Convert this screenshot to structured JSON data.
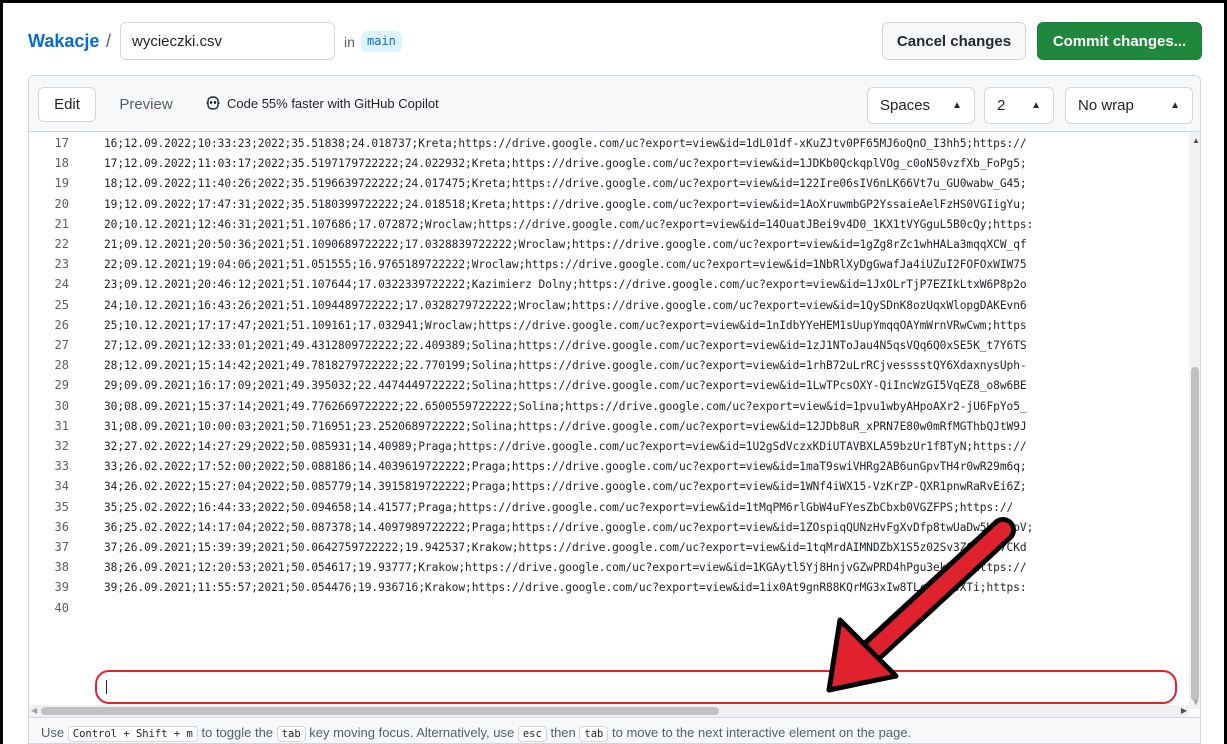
{
  "header": {
    "repo": "Wakacje",
    "separator": "/",
    "filename": "wycieczki.csv",
    "in_label": "in",
    "branch": "main",
    "cancel_label": "Cancel changes",
    "commit_label": "Commit changes..."
  },
  "toolbar": {
    "edit_label": "Edit",
    "preview_label": "Preview",
    "copilot_text": "Code 55% faster with GitHub Copilot",
    "indent_mode": "Spaces",
    "indent_size": "2",
    "wrap_mode": "No wrap"
  },
  "editor": {
    "lines": [
      {
        "num": "17",
        "text": "16;12.09.2022;10:33:23;2022;35.51838;24.018737;Kreta;https://drive.google.com/uc?export=view&id=1dL01df-xKuZJtv0PF65MJ6oQnO_I3hh5;https://"
      },
      {
        "num": "18",
        "text": "17;12.09.2022;11:03:17;2022;35.5197179722222;24.022932;Kreta;https://drive.google.com/uc?export=view&id=1JDKb0QckqplVOg_c0oN50vzfXb_FoPg5;"
      },
      {
        "num": "19",
        "text": "18;12.09.2022;11:40:26;2022;35.5196639722222;24.017475;Kreta;https://drive.google.com/uc?export=view&id=122Ire06sIV6nLK66Vt7u_GU0wabw_G45;"
      },
      {
        "num": "20",
        "text": "19;12.09.2022;17:47:31;2022;35.5180399722222;24.018518;Kreta;https://drive.google.com/uc?export=view&id=1AoXruwmbGP2YssaieAelFzHS0VGIigYu;"
      },
      {
        "num": "21",
        "text": "20;10.12.2021;12:46:31;2021;51.107686;17.072872;Wroclaw;https://drive.google.com/uc?export=view&id=14OuatJBei9v4D0_1KX1tVYGguL5B0cQy;https:"
      },
      {
        "num": "22",
        "text": "21;09.12.2021;20:50:36;2021;51.1090689722222;17.0328839722222;Wroclaw;https://drive.google.com/uc?export=view&id=1gZg8rZc1whHALa3mqqXCW_qf"
      },
      {
        "num": "23",
        "text": "22;09.12.2021;19:04:06;2021;51.051555;16.9765189722222;Wroclaw;https://drive.google.com/uc?export=view&id=1NbRlXyDgGwafJa4iUZuI2FOFOxWIW75"
      },
      {
        "num": "24",
        "text": "23;09.12.2021;20:46:12;2021;51.107644;17.0322339722222;Kazimierz Dolny;https://drive.google.com/uc?export=view&id=1JxOLrTjP7EZIkLtxW6P8p2o"
      },
      {
        "num": "25",
        "text": "24;10.12.2021;16:43:26;2021;51.1094489722222;17.0328279722222;Wroclaw;https://drive.google.com/uc?export=view&id=1QySDnK8ozUqxWlopgDAKEvn6"
      },
      {
        "num": "26",
        "text": "25;10.12.2021;17:17:47;2021;51.109161;17.032941;Wroclaw;https://drive.google.com/uc?export=view&id=1nIdbYYeHEM1sUupYmqqOAYmWrnVRwCwm;https"
      },
      {
        "num": "27",
        "text": "27;12.09.2021;12:33:01;2021;49.4312809722222;22.409389;Solina;https://drive.google.com/uc?export=view&id=1zJ1NToJau4N5qsVQq6Q0xSE5K_t7Y6TS"
      },
      {
        "num": "28",
        "text": "28;12.09.2021;15:14:42;2021;49.7818279722222;22.770199;Solina;https://drive.google.com/uc?export=view&id=1rhB72uLrRCjvesssstQY6XdaxnysUph-"
      },
      {
        "num": "29",
        "text": "29;09.09.2021;16:17:09;2021;49.395032;22.4474449722222;Solina;https://drive.google.com/uc?export=view&id=1LwTPcsOXY-QiIncWzGI5VqEZ8_o8w6BE"
      },
      {
        "num": "30",
        "text": "30;08.09.2021;15:37:14;2021;49.7762669722222;22.6500559722222;Solina;https://drive.google.com/uc?export=view&id=1pvu1wbyAHpoAXr2-jU6FpYo5_"
      },
      {
        "num": "31",
        "text": "31;08.09.2021;10:00:03;2021;50.716951;23.2520689722222;Solina;https://drive.google.com/uc?export=view&id=12JDb8uR_xPRN7E80w0mRfMGThbQJtW9J"
      },
      {
        "num": "32",
        "text": "32;27.02.2022;14:27:29;2022;50.085931;14.40989;Praga;https://drive.google.com/uc?export=view&id=1U2gSdVczxKDiUTAVBXLA59bzUr1f8TyN;https://"
      },
      {
        "num": "33",
        "text": "33;26.02.2022;17:52:00;2022;50.088186;14.4039619722222;Praga;https://drive.google.com/uc?export=view&id=1maT9swiVHRg2AB6unGpvTH4r0wR29m6q;"
      },
      {
        "num": "34",
        "text": "34;26.02.2022;15:27:04;2022;50.085779;14.3915819722222;Praga;https://drive.google.com/uc?export=view&id=1WNf4iWX15-VzKrZP-QXR1pnwRaRvEi6Z;"
      },
      {
        "num": "35",
        "text": "35;25.02.2022;16:44:33;2022;50.094658;14.41577;Praga;https://drive.google.com/uc?export=view&id=1tMqPM6rlGbW4uFYesZbCbxb0VGZFPS;https://"
      },
      {
        "num": "36",
        "text": "36;25.02.2022;14:17:04;2022;50.087378;14.4097989722222;Praga;https://drive.google.com/uc?export=view&id=1ZOspiqQUNzHvFgXvDfp8twUaDw5HgDuoV;"
      },
      {
        "num": "37",
        "text": "37;26.09.2021;15:39:39;2021;50.0642759722222;19.942537;Krakow;https://drive.google.com/uc?export=view&id=1tqMrdAIMNDZbX1S5z02Sv3ZGw4wt7CKd"
      },
      {
        "num": "38",
        "text": "38;26.09.2021;12:20:53;2021;50.054617;19.93777;Krakow;https://drive.google.com/uc?export=view&id=1KGAytl5Yj8HnjvGZwPRD4hPgu3ekIME;https://"
      },
      {
        "num": "39",
        "text": "39;26.09.2021;11:55:57;2021;50.054476;19.936716;Krakow;https://drive.google.com/uc?export=view&id=1ix0At9gnR88KQrMG3xIw8TLctPOHsXTi;https:"
      },
      {
        "num": "40",
        "text": ""
      }
    ]
  },
  "hint": {
    "p1": "Use",
    "k1": "Control + Shift + m",
    "p2": "to toggle the",
    "k2": "tab",
    "p3": "key moving focus. Alternatively, use",
    "k3": "esc",
    "p4": "then",
    "k4": "tab",
    "p5": "to move to the next interactive element on the page."
  },
  "colors": {
    "accent": "#0969da",
    "commit": "#1f883d",
    "annotation": "#e0222f"
  }
}
